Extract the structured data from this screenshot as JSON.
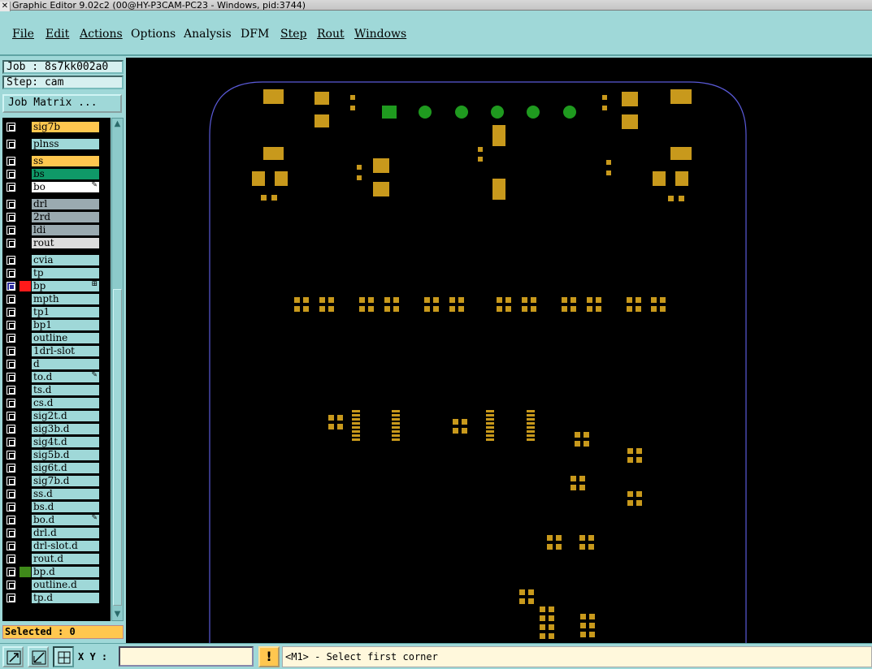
{
  "window": {
    "title": "Graphic Editor 9.02c2 (00@HY-P3CAM-PC23 - Windows, pid:3744)"
  },
  "menu": [
    {
      "label": "File"
    },
    {
      "label": "Edit"
    },
    {
      "label": "Actions"
    },
    {
      "label": "Options"
    },
    {
      "label": "Analysis"
    },
    {
      "label": "DFM"
    },
    {
      "label": "Step"
    },
    {
      "label": "Rout"
    },
    {
      "label": "Windows"
    }
  ],
  "job": {
    "job_text": "Job : 8s7kk002a0",
    "step_text": "Step: cam",
    "matrix_button": "Job Matrix ..."
  },
  "layers": [
    {
      "name": "sig7b",
      "color": "#ffc74f",
      "group": 0
    },
    {
      "name": "plnss",
      "color": "#9fd8d8",
      "group": 1
    },
    {
      "name": "ss",
      "color": "#ffc74f",
      "group": 2
    },
    {
      "name": "bs",
      "color": "#0f9968",
      "group": 2
    },
    {
      "name": "bo",
      "color": "#ffffff",
      "group": 2,
      "mark": "edit-mark"
    },
    {
      "name": "drl",
      "color": "#9aaab0",
      "group": 3
    },
    {
      "name": "2rd",
      "color": "#9aaab0",
      "group": 3
    },
    {
      "name": "ldi",
      "color": "#9aaab0",
      "group": 3
    },
    {
      "name": "rout",
      "color": "#dddddd",
      "group": 3
    },
    {
      "name": "cvia",
      "color": "#9fd8d8",
      "group": 4
    },
    {
      "name": "tp",
      "color": "#9fd8d8",
      "group": 4
    },
    {
      "name": "bp",
      "color": "#9fd8d8",
      "group": 4,
      "active": true,
      "swatch": "#ff1a1a",
      "mark": "work-mark"
    },
    {
      "name": "mpth",
      "color": "#9fd8d8",
      "group": 4
    },
    {
      "name": "tp1",
      "color": "#9fd8d8",
      "group": 4
    },
    {
      "name": "bp1",
      "color": "#9fd8d8",
      "group": 4
    },
    {
      "name": "outline",
      "color": "#9fd8d8",
      "group": 4
    },
    {
      "name": "1drl-slot",
      "color": "#9fd8d8",
      "group": 4
    },
    {
      "name": "d",
      "color": "#9fd8d8",
      "group": 4
    },
    {
      "name": "to.d",
      "color": "#9fd8d8",
      "group": 4,
      "mark": "edit-mark"
    },
    {
      "name": "ts.d",
      "color": "#9fd8d8",
      "group": 4
    },
    {
      "name": "cs.d",
      "color": "#9fd8d8",
      "group": 4
    },
    {
      "name": "sig2t.d",
      "color": "#9fd8d8",
      "group": 4
    },
    {
      "name": "sig3b.d",
      "color": "#9fd8d8",
      "group": 4
    },
    {
      "name": "sig4t.d",
      "color": "#9fd8d8",
      "group": 4
    },
    {
      "name": "sig5b.d",
      "color": "#9fd8d8",
      "group": 4
    },
    {
      "name": "sig6t.d",
      "color": "#9fd8d8",
      "group": 4
    },
    {
      "name": "sig7b.d",
      "color": "#9fd8d8",
      "group": 4
    },
    {
      "name": "ss.d",
      "color": "#9fd8d8",
      "group": 4
    },
    {
      "name": "bs.d",
      "color": "#9fd8d8",
      "group": 4
    },
    {
      "name": "bo.d",
      "color": "#9fd8d8",
      "group": 4,
      "mark": "edit-mark"
    },
    {
      "name": "drl.d",
      "color": "#9fd8d8",
      "group": 4
    },
    {
      "name": "drl-slot.d",
      "color": "#9fd8d8",
      "group": 4
    },
    {
      "name": "rout.d",
      "color": "#9fd8d8",
      "group": 4
    },
    {
      "name": "bp.d",
      "color": "#9fd8d8",
      "group": 4,
      "swatch": "#3f8a1a"
    },
    {
      "name": "outline.d",
      "color": "#9fd8d8",
      "group": 4
    },
    {
      "name": "tp.d",
      "color": "#9fd8d8",
      "group": 4
    }
  ],
  "selected_text": "Selected : 0",
  "status": {
    "xy_label": "X Y :",
    "xy_value": "",
    "alert_label": "!",
    "prompt": "<M1> - Select first corner"
  },
  "colors": {
    "pad": "#c8991c",
    "via": "#1f9a1f",
    "outline": "#5a5ad8",
    "canvas": "#000000",
    "panel": "#9fd8d8"
  },
  "icons": {
    "tool1": "zoom-area-icon",
    "tool2": "measure-icon",
    "tool3": "snap-grid-icon"
  }
}
